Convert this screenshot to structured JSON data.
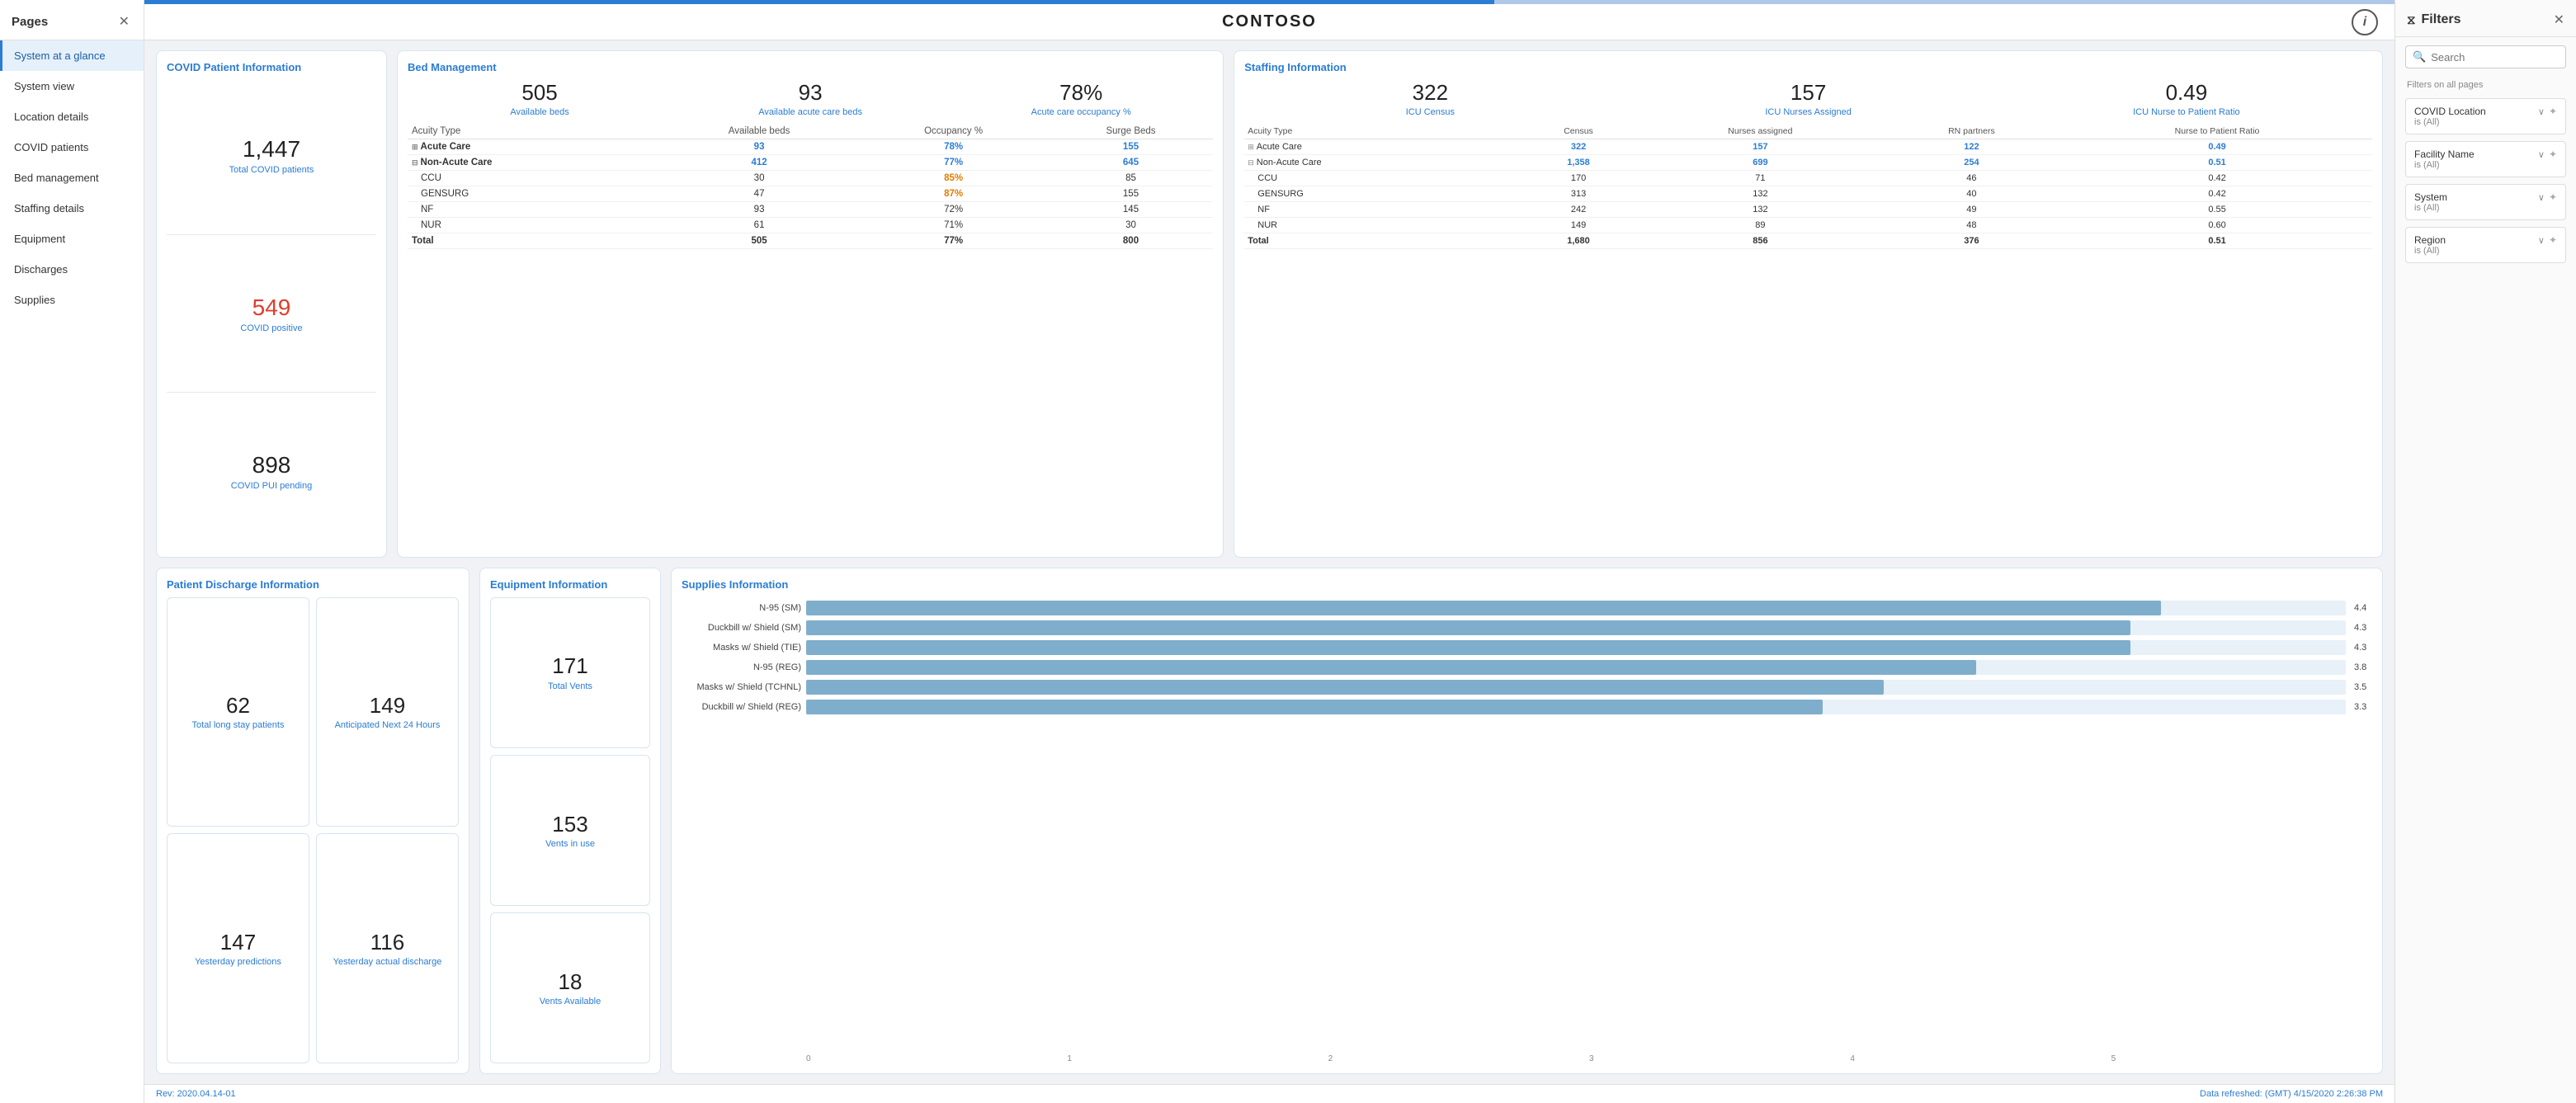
{
  "sidebar": {
    "header": "Pages",
    "items": [
      {
        "label": "System at a glance",
        "active": true
      },
      {
        "label": "System view",
        "active": false
      },
      {
        "label": "Location details",
        "active": false
      },
      {
        "label": "COVID patients",
        "active": false
      },
      {
        "label": "Bed management",
        "active": false
      },
      {
        "label": "Staffing details",
        "active": false
      },
      {
        "label": "Equipment",
        "active": false
      },
      {
        "label": "Discharges",
        "active": false
      },
      {
        "label": "Supplies",
        "active": false
      }
    ]
  },
  "topbar": {
    "title": "CONTOSO"
  },
  "covid": {
    "section_title": "COVID Patient Information",
    "total_value": "1,447",
    "total_label": "Total COVID patients",
    "positive_value": "549",
    "positive_label": "COVID positive",
    "pui_value": "898",
    "pui_label": "COVID PUI pending"
  },
  "bed": {
    "section_title": "Bed Management",
    "metrics": [
      {
        "value": "505",
        "label": "Available beds"
      },
      {
        "value": "93",
        "label": "Available acute care beds"
      },
      {
        "value": "78%",
        "label": "Acute care occupancy %"
      }
    ],
    "table": {
      "headers": [
        "Acuity Type",
        "Available beds",
        "Occupancy %",
        "Surge Beds"
      ],
      "rows": [
        {
          "type": "Acute Care",
          "available": "93",
          "occupancy": "78%",
          "surge": "155",
          "group": true,
          "highlight_occ": "blue"
        },
        {
          "type": "Non-Acute Care",
          "available": "412",
          "occupancy": "77%",
          "surge": "645",
          "group": true,
          "highlight_occ": "blue"
        },
        {
          "type": "CCU",
          "available": "30",
          "occupancy": "85%",
          "surge": "85",
          "indent": true,
          "highlight_occ": "orange"
        },
        {
          "type": "GENSURG",
          "available": "47",
          "occupancy": "87%",
          "surge": "155",
          "indent": true,
          "highlight_occ": "orange"
        },
        {
          "type": "NF",
          "available": "93",
          "occupancy": "72%",
          "surge": "145",
          "indent": true
        },
        {
          "type": "NUR",
          "available": "61",
          "occupancy": "71%",
          "surge": "30",
          "indent": true
        }
      ],
      "total": {
        "type": "Total",
        "available": "505",
        "occupancy": "77%",
        "surge": "800"
      }
    }
  },
  "staffing": {
    "section_title": "Staffing Information",
    "metrics": [
      {
        "value": "322",
        "label": "ICU Census"
      },
      {
        "value": "157",
        "label": "ICU Nurses Assigned"
      },
      {
        "value": "0.49",
        "label": "ICU Nurse to Patient Ratio"
      }
    ],
    "table": {
      "headers": [
        "Acuity Type",
        "Census",
        "Nurses assigned",
        "RN partners",
        "Nurse to Patient Ratio"
      ],
      "rows": [
        {
          "type": "Acute Care",
          "census": "322",
          "nurses": "157",
          "rn": "122",
          "ratio": "0.49",
          "group": true
        },
        {
          "type": "Non-Acute Care",
          "census": "1,358",
          "nurses": "699",
          "rn": "254",
          "ratio": "0.51",
          "group": true
        },
        {
          "type": "CCU",
          "census": "170",
          "nurses": "71",
          "rn": "46",
          "ratio": "0.42",
          "indent": true
        },
        {
          "type": "GENSURG",
          "census": "313",
          "nurses": "132",
          "rn": "40",
          "ratio": "0.42",
          "indent": true
        },
        {
          "type": "NF",
          "census": "242",
          "nurses": "132",
          "rn": "49",
          "ratio": "0.55",
          "indent": true
        },
        {
          "type": "NUR",
          "census": "149",
          "nurses": "89",
          "rn": "48",
          "ratio": "0.60",
          "indent": true
        }
      ],
      "total": {
        "type": "Total",
        "census": "1,680",
        "nurses": "856",
        "rn": "376",
        "ratio": "0.51"
      }
    }
  },
  "discharge": {
    "section_title": "Patient Discharge Information",
    "cells": [
      {
        "value": "62",
        "label": "Total long stay patients"
      },
      {
        "value": "149",
        "label": "Anticipated Next 24 Hours"
      },
      {
        "value": "147",
        "label": "Yesterday predictions"
      },
      {
        "value": "116",
        "label": "Yesterday actual discharge"
      }
    ]
  },
  "equipment": {
    "section_title": "Equipment Information",
    "cells": [
      {
        "value": "171",
        "label": "Total Vents"
      },
      {
        "value": "153",
        "label": "Vents in use"
      },
      {
        "value": "18",
        "label": "Vents Available"
      }
    ]
  },
  "supplies": {
    "section_title": "Supplies Information",
    "max_value": 5,
    "axis_labels": [
      "0",
      "1",
      "2",
      "3",
      "4",
      "5"
    ],
    "items": [
      {
        "label": "N-95 (SM)",
        "value": 4.4
      },
      {
        "label": "Duckbill w/ Shield (SM)",
        "value": 4.3
      },
      {
        "label": "Masks w/ Shield (TIE)",
        "value": 4.3
      },
      {
        "label": "N-95 (REG)",
        "value": 3.8
      },
      {
        "label": "Masks w/ Shield (TCHNL)",
        "value": 3.5
      },
      {
        "label": "Duckbill w/ Shield (REG)",
        "value": 3.3
      }
    ]
  },
  "footer": {
    "rev": "Rev: 2020.04.14-01",
    "refresh": "Data refreshed: (GMT)",
    "refresh_time": "4/15/2020 2:26:38 PM"
  },
  "filters": {
    "title": "Filters",
    "search_placeholder": "Search",
    "section_label": "Filters on all pages",
    "items": [
      {
        "name": "COVID Location",
        "value": "is (All)"
      },
      {
        "name": "Facility Name",
        "value": "is (All)"
      },
      {
        "name": "System",
        "value": "is (All)"
      },
      {
        "name": "Region",
        "value": "is (All)"
      }
    ]
  }
}
